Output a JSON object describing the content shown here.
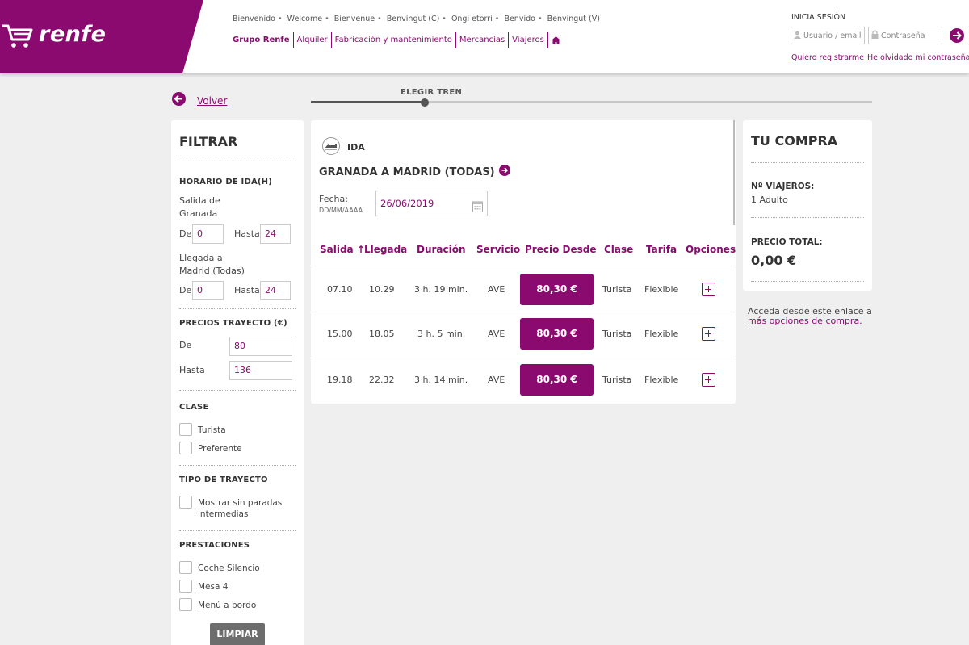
{
  "brand": {
    "logo_text": "renfe",
    "color": "#8b0a6f"
  },
  "header": {
    "languages": [
      "Bienvenido",
      "Welcome",
      "Bienvenue",
      "Benvingut (C)",
      "Ongi etorri",
      "Benvido",
      "Benvingut (V)"
    ],
    "nav": [
      "Grupo Renfe",
      "Alquiler",
      "Fabricación y mantenimiento",
      "Mercancías",
      "Viajeros"
    ],
    "home_icon": "home-icon",
    "login": {
      "title": "INICIA SESIÓN",
      "user_placeholder": "Usuario / email",
      "pass_placeholder": "Contraseña",
      "register": "Quiero registrarme",
      "forgot": "He olvidado mi contraseña"
    }
  },
  "back": {
    "label": "Volver"
  },
  "progress": {
    "step_label": "ELEGIR TREN"
  },
  "filter": {
    "title": "FILTRAR",
    "schedule_title": "HORARIO DE IDA(H)",
    "departure_label": "Salida de Granada",
    "departure_from_label": "De",
    "departure_from": "0",
    "departure_to_label": "Hasta",
    "departure_to": "24",
    "arrival_label": "Llegada a Madrid (Todas)",
    "arrival_from_label": "De",
    "arrival_from": "0",
    "arrival_to_label": "Hasta",
    "arrival_to": "24",
    "prices_title": "PRECIOS TRAYECTO (€)",
    "price_from_label": "De",
    "price_from": "80",
    "price_to_label": "Hasta",
    "price_to": "136",
    "class_title": "CLASE",
    "class_options": [
      "Turista",
      "Preferente"
    ],
    "trip_type_title": "TIPO DE TRAYECTO",
    "trip_type_option": "Mostrar sin paradas intermedias",
    "services_title": "PRESTACIONES",
    "services_options": [
      "Coche Silencio",
      "Mesa 4",
      "Menú a bordo"
    ],
    "clear_button": "LIMPIAR"
  },
  "results": {
    "direction": "IDA",
    "route": "GRANADA A MADRID (TODAS)",
    "date_label": "Fecha:",
    "date_format": "DD/MM/AAAA",
    "date_value": "26/06/2019",
    "columns": [
      "Salida ↑",
      "Llegada",
      "Duración",
      "Servicio",
      "Precio Desde",
      "Clase",
      "Tarifa",
      "Opciones"
    ],
    "rows": [
      {
        "salida": "07.10",
        "llegada": "10.29",
        "duracion": "3 h. 19 min.",
        "servicio": "AVE",
        "precio": "80,30 €",
        "clase": "Turista",
        "tarifa": "Flexible"
      },
      {
        "salida": "15.00",
        "llegada": "18.05",
        "duracion": "3 h. 5 min.",
        "servicio": "AVE",
        "precio": "80,30 €",
        "clase": "Turista",
        "tarifa": "Flexible"
      },
      {
        "salida": "19.18",
        "llegada": "22.32",
        "duracion": "3 h. 14 min.",
        "servicio": "AVE",
        "precio": "80,30 €",
        "clase": "Turista",
        "tarifa": "Flexible"
      }
    ]
  },
  "purchase": {
    "title": "TU COMPRA",
    "travelers_label": "Nº VIAJEROS:",
    "travelers_value": "1 Adulto",
    "total_label": "PRECIO TOTAL:",
    "total_value": "0,00 €",
    "more_text": "Acceda desde este enlace a",
    "more_link": "más opciones de compra."
  }
}
